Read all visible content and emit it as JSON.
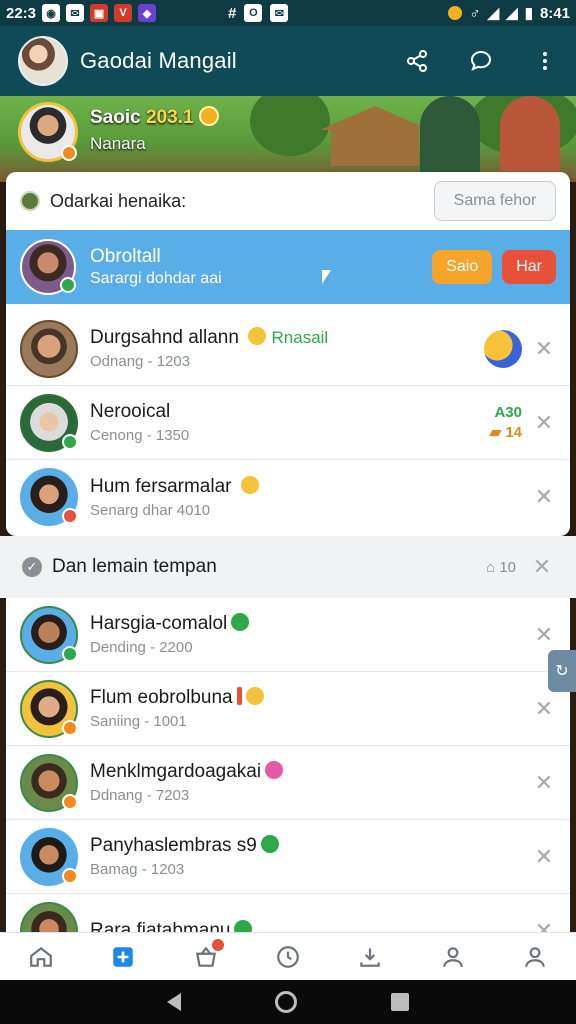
{
  "status_bar": {
    "time": "22:3",
    "clock_right": "8:41"
  },
  "app_bar": {
    "title": "Gaodai Mangail"
  },
  "banner": {
    "name": "Saoic",
    "score": "203.1",
    "subtitle": "Nanara"
  },
  "card": {
    "header_label": "Odarkai henaika:",
    "header_button": "Sama fehor"
  },
  "active_chat": {
    "name": "Obroltall",
    "subtitle": "Sarargi dohdar aai",
    "accept_label": "Saio",
    "decline_label": "Har"
  },
  "chats": [
    {
      "name": "Durgsahnd allann",
      "tag": "Rnasail",
      "sub": "Odnang - 1203"
    },
    {
      "name": "Nerooical",
      "sub": "Cenong - 1350",
      "stat_top": "A30",
      "stat_bottom": "14"
    },
    {
      "name": "Hum fersarmalar",
      "sub": "Senarg dhar 4010"
    }
  ],
  "section": {
    "label": "Dan lemain tempan",
    "count": "10"
  },
  "friends": [
    {
      "name": "Harsgia-comalol",
      "sub": "Dending - 2200"
    },
    {
      "name": "Flum eobrolbuna",
      "sub": "Saniing - 1001"
    },
    {
      "name": "Menklmgardoagakai",
      "sub": "Ddnang - 7203"
    },
    {
      "name": "Panyhaslembras s9",
      "sub": "Bamag - 1203"
    },
    {
      "name": "Rara fiatabmanu",
      "sub": ""
    }
  ],
  "colors": {
    "app_bar": "#104a57",
    "active_row": "#5aaee8",
    "accept": "#f6a52a",
    "decline": "#e9503a",
    "online": "#2da84a"
  }
}
